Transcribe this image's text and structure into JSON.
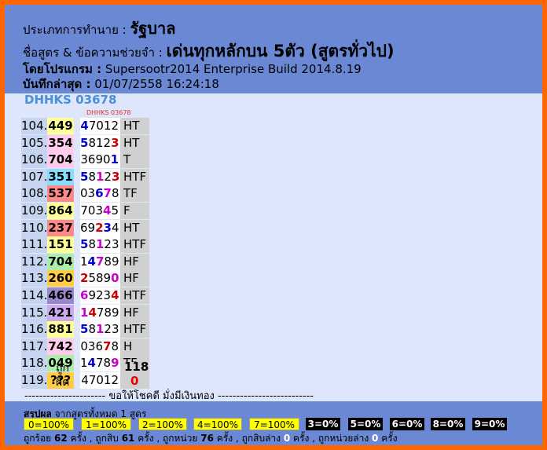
{
  "header": {
    "predict_type_label": "ประเภทการทำนาย :",
    "predict_type_value": "รัฐบาล",
    "formula_label": "ชื่อสูตร & ข้อความช่วยจำ :",
    "formula_value": "เด่นทุกหลักบน 5ตัว (สูตรทั่วไป)",
    "program_label": "โดยโปรแกรม :",
    "program_value": "Supersootr2014 Enterprise Build 2014.8.19",
    "saved_label": "บันทึกล่าสุด :",
    "saved_value": "01/07/2558 16:24:18"
  },
  "formula_code": "DHHKS 03678",
  "column_code": "DHHKS 03678",
  "rows": [
    {
      "n": "104.",
      "p": "449",
      "pc": "#ffff99",
      "r": [
        [
          "4",
          "b"
        ],
        [
          "7012",
          ""
        ]
      ],
      "t": "HT"
    },
    {
      "n": "105.",
      "p": "354",
      "pc": "#ffccee",
      "r": [
        [
          "5",
          "b"
        ],
        [
          "812",
          ""
        ],
        [
          "3",
          "r"
        ]
      ],
      "t": "HT"
    },
    {
      "n": "106.",
      "p": "704",
      "pc": "#ffccee",
      "r": [
        [
          "3690",
          ""
        ],
        [
          "1",
          "b"
        ]
      ],
      "t": "T"
    },
    {
      "n": "107.",
      "p": "351",
      "pc": "#88ddff",
      "r": [
        [
          "5",
          "b"
        ],
        [
          "8",
          ""
        ],
        [
          "1",
          "m"
        ],
        [
          "2",
          ""
        ],
        [
          "3",
          "r"
        ]
      ],
      "t": "HTF"
    },
    {
      "n": "108.",
      "p": "537",
      "pc": "#ff8888",
      "r": [
        [
          "03",
          ""
        ],
        [
          "6",
          "b"
        ],
        [
          "7",
          "m"
        ],
        [
          "8",
          ""
        ]
      ],
      "t": "TF"
    },
    {
      "n": "109.",
      "p": "864",
      "pc": "#ffff99",
      "r": [
        [
          "703",
          ""
        ],
        [
          "4",
          "m"
        ],
        [
          "5",
          ""
        ]
      ],
      "t": "F"
    },
    {
      "n": "110.",
      "p": "237",
      "pc": "#ff8888",
      "r": [
        [
          "69",
          ""
        ],
        [
          "2",
          "r"
        ],
        [
          "3",
          "b"
        ],
        [
          "4",
          ""
        ]
      ],
      "t": "HT"
    },
    {
      "n": "111.",
      "p": "151",
      "pc": "#ffff99",
      "r": [
        [
          "5",
          "b"
        ],
        [
          "8",
          ""
        ],
        [
          "1",
          "m"
        ],
        [
          "23",
          ""
        ]
      ],
      "t": "HTF"
    },
    {
      "n": "112.",
      "p": "704",
      "pc": "#aaeeaa",
      "r": [
        [
          "1",
          ""
        ],
        [
          "4",
          "b"
        ],
        [
          "7",
          "m"
        ],
        [
          "89",
          ""
        ]
      ],
      "t": "HF"
    },
    {
      "n": "113.",
      "p": "260",
      "pc": "#ffcc44",
      "r": [
        [
          "2",
          "r"
        ],
        [
          "589",
          ""
        ],
        [
          "0",
          "m"
        ]
      ],
      "t": "HF"
    },
    {
      "n": "114.",
      "p": "466",
      "pc": "#9988cc",
      "r": [
        [
          "6",
          "m"
        ],
        [
          "923",
          ""
        ],
        [
          "4",
          "r"
        ]
      ],
      "t": "HTF"
    },
    {
      "n": "115.",
      "p": "421",
      "pc": "#ccaaee",
      "r": [
        [
          "1",
          "m"
        ],
        [
          "4",
          "r"
        ],
        [
          "789",
          ""
        ]
      ],
      "t": "HF"
    },
    {
      "n": "116.",
      "p": "881",
      "pc": "#ffff99",
      "r": [
        [
          "5",
          "b"
        ],
        [
          "8",
          ""
        ],
        [
          "1",
          "m"
        ],
        [
          "23",
          ""
        ]
      ],
      "t": "HTF"
    },
    {
      "n": "117.",
      "p": "742",
      "pc": "#ffccee",
      "r": [
        [
          "036",
          ""
        ],
        [
          "7",
          "r"
        ],
        [
          "8",
          ""
        ]
      ],
      "t": "H"
    },
    {
      "n": "118.",
      "p": "049",
      "pc": "#aaeeaa",
      "r": [
        [
          "1",
          ""
        ],
        [
          "4",
          "b"
        ],
        [
          "78",
          ""
        ],
        [
          "9",
          "m"
        ]
      ],
      "t": "TF"
    },
    {
      "n": "119.",
      "p": "???",
      "pc": "#ffcc44",
      "r": [
        [
          "47012",
          ""
        ]
      ],
      "t": ""
    }
  ],
  "summary_col": {
    "correct_label": "ถูก",
    "correct_value": "118",
    "wrong_label": "ผิด",
    "wrong_value": "0"
  },
  "divider_text": "---------------------- ขอให้โชคดี มั่งมีเงินทอง --------------------------",
  "footer": {
    "summary_label": "สรุปผล",
    "summary_text": "จากสูตรทั้งหมด 1 สูตร",
    "badges": [
      {
        "t": "0=100%",
        "k": "y"
      },
      {
        "t": "1=100%",
        "k": "y"
      },
      {
        "t": "2=100%",
        "k": "y"
      },
      {
        "t": "4=100%",
        "k": "y"
      },
      {
        "t": "7=100%",
        "k": "y"
      },
      {
        "t": "3=0%",
        "k": "k"
      },
      {
        "t": "5=0%",
        "k": "k"
      },
      {
        "t": "6=0%",
        "k": "k"
      },
      {
        "t": "8=0%",
        "k": "k"
      },
      {
        "t": "9=0%",
        "k": "k"
      }
    ],
    "stats": {
      "s1_label": "ถูกร้อย",
      "s1_val": "62",
      "s1_unit": "ครั้ง ,",
      "s2_label": "ถูกสิบ",
      "s2_val": "61",
      "s2_unit": "ครั้ง ,",
      "s3_label": "ถูกหน่วย",
      "s3_val": "76",
      "s3_unit": "ครั้ง ,",
      "s4_label": "ถูกสิบล่าง",
      "s4_val": "0",
      "s4_unit": "ครั้ง ,",
      "s5_label": "ถูกหน่วยล่าง",
      "s5_val": "0",
      "s5_unit": "ครั้ง"
    }
  }
}
